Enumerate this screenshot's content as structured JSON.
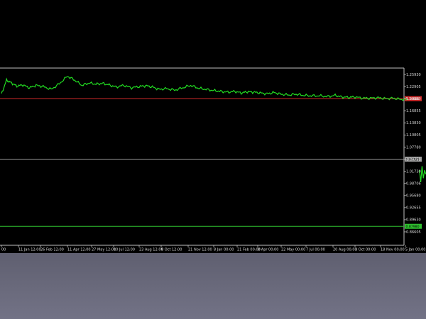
{
  "colors": {
    "background": "#000000",
    "price_line": "#22dd22",
    "axis": "#bfbfbf",
    "red_level": "#d42a2a",
    "grey_level": "#9a9a9a",
    "green_level": "#2fbf2f",
    "bottom_panel": "#6b6b7d"
  },
  "icons": [],
  "chart_data": {
    "type": "line",
    "title": "",
    "xlabel": "",
    "ylabel": "",
    "ylim": [
      0.85,
      1.27
    ],
    "grid": false,
    "legend": "none",
    "y_ticks": [
      "1.25930",
      "1.22905",
      "1.19880",
      "1.16855",
      "1.13830",
      "1.10805",
      "1.07780",
      "1.04755",
      "1.01730",
      "0.98706",
      "0.95680",
      "0.92655",
      "0.89630",
      "0.86605"
    ],
    "y_tick_values": [
      1.2593,
      1.22905,
      1.1988,
      1.16855,
      1.1383,
      1.10805,
      1.0778,
      1.04755,
      1.0173,
      0.98706,
      0.9568,
      0.92655,
      0.8963,
      0.86605
    ],
    "x_ticks": [
      "00",
      "11 Jan 12:00",
      "26 Feb 12:00",
      "11 Apr 12:00",
      "27 May 12:00",
      "10 Jul 12:00",
      "23 Aug 12:00",
      "8 Oct 12:00",
      "21 Nov 12:00",
      "8 Jan 00:00",
      "21 Feb 00:00",
      "8 Apr 00:00",
      "22 May 00:00",
      "7 Jul 00:00",
      "20 Aug 00:00",
      "3 Oct 00:00",
      "18 Nov 00:00",
      "5 Jan 00:00"
    ],
    "x_tick_index": [
      0,
      1,
      2,
      3,
      4,
      5,
      6,
      7,
      8,
      9,
      10,
      11,
      12,
      13,
      14,
      15,
      16,
      17
    ],
    "series": [
      {
        "x": [
          0,
          0.3,
          0.6,
          0.9,
          1.2,
          1.5,
          1.8,
          2.1,
          2.4,
          2.7,
          3.0,
          3.3,
          3.6,
          3.9,
          4.2,
          4.5,
          4.8,
          5.1,
          5.4,
          5.7,
          6.0,
          6.3,
          6.6,
          6.9,
          7.2,
          7.5,
          7.8,
          8.1,
          8.4,
          8.7,
          9.0,
          9.3,
          9.6,
          9.9,
          10.2,
          10.5,
          10.8,
          11.1,
          11.4,
          11.7,
          12.0,
          12.3,
          12.6,
          12.9,
          13.2,
          13.5,
          13.8,
          14.1,
          14.4,
          14.7,
          15.0,
          15.3,
          15.6,
          15.9,
          16.2,
          16.5,
          16.8,
          17.1
        ],
        "values": [
          1.21,
          1.245,
          1.238,
          1.23,
          1.233,
          1.226,
          1.232,
          1.229,
          1.222,
          1.236,
          1.255,
          1.245,
          1.232,
          1.238,
          1.235,
          1.237,
          1.233,
          1.228,
          1.232,
          1.226,
          1.229,
          1.231,
          1.228,
          1.222,
          1.224,
          1.22,
          1.226,
          1.232,
          1.225,
          1.222,
          1.219,
          1.217,
          1.215,
          1.217,
          1.213,
          1.216,
          1.215,
          1.213,
          1.211,
          1.214,
          1.21,
          1.208,
          1.21,
          1.207,
          1.206,
          1.206,
          1.204,
          1.207,
          1.203,
          1.202,
          1.203,
          1.2,
          1.2,
          1.201,
          1.199,
          1.2,
          1.197,
          1.197
        ]
      }
    ],
    "late_segment": {
      "x": [
        17.55,
        17.6,
        17.65,
        17.7,
        17.75,
        17.8
      ],
      "values": [
        1.02,
        0.99,
        1.03,
        1.0,
        1.02,
        1.01
      ]
    },
    "horizontal_levels": [
      {
        "value": 1.1988,
        "label": "1.19880",
        "color": "#d42a2a"
      },
      {
        "value": 1.04755,
        "label": "1.04755",
        "color": "#9a9a9a"
      },
      {
        "value": 0.8798,
        "label": "0.87980",
        "color": "#2fbf2f"
      }
    ]
  }
}
